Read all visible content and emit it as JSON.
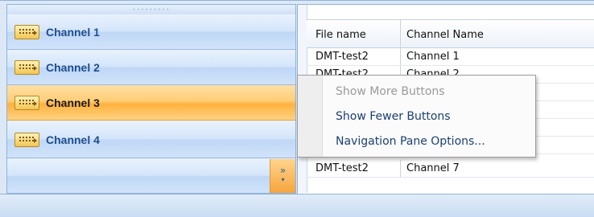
{
  "navigation": {
    "grip": "·········",
    "items": [
      {
        "label": "Channel 1",
        "selected": false
      },
      {
        "label": "Channel 2",
        "selected": false
      },
      {
        "label": "Channel 3",
        "selected": true
      },
      {
        "label": "Channel 4",
        "selected": false
      }
    ],
    "overflow_chevron": "»",
    "overflow_arrow": "▾",
    "item_icon": "channel-icon"
  },
  "grid": {
    "headers": [
      "File name",
      "Channel Name"
    ],
    "rows": [
      [
        "DMT-test2",
        "Channel 1"
      ],
      [
        "DMT-test2",
        "Channel 2"
      ],
      [
        "DMT-test2",
        "Channel 7"
      ]
    ]
  },
  "context_menu": {
    "items": [
      {
        "label": "Show More Buttons",
        "enabled": false
      },
      {
        "label": "Show Fewer Buttons",
        "enabled": true
      },
      {
        "label": "Navigation Pane Options...",
        "enabled": true
      }
    ]
  },
  "colors": {
    "selected_item": "#ffb13d",
    "nav_text": "#1f4e8e",
    "menu_text": "#1b3f73",
    "disabled_text": "#9a9a9a"
  }
}
